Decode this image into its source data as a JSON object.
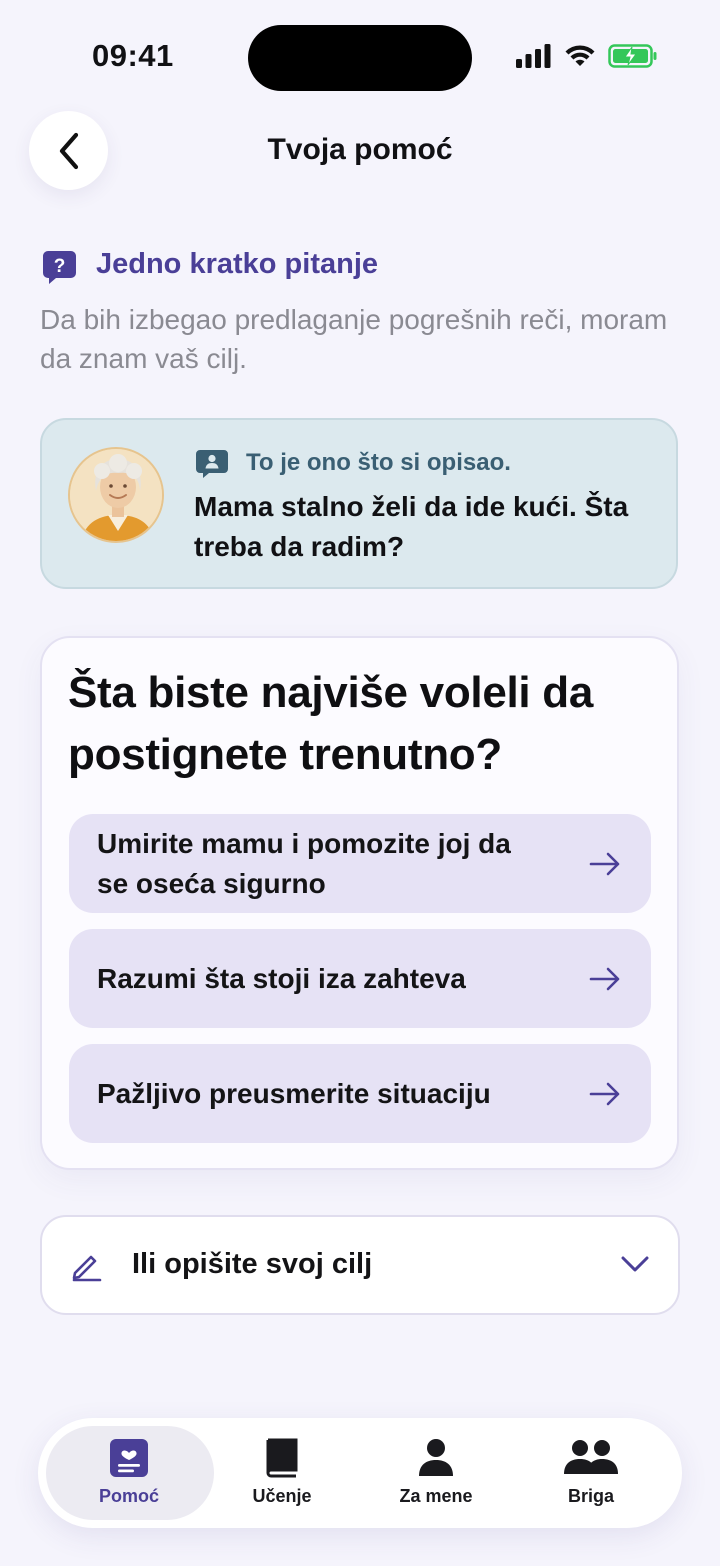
{
  "status_bar": {
    "time": "09:41"
  },
  "header": {
    "title": "Tvoja pomoć"
  },
  "question": {
    "title": "Jedno kratko pitanje",
    "subtitle": "Da bih izbegao predlaganje pogrešnih reči, moram da znam vaš cilj."
  },
  "described": {
    "label": "To je ono što si opisao.",
    "text": "Mama stalno želi da ide kući. Šta treba da radim?"
  },
  "goal": {
    "title": "Šta biste najviše voleli da postignete trenutno?",
    "options": [
      {
        "label": "Umirite mamu i pomozite joj da se oseća sigurno"
      },
      {
        "label": "Razumi šta stoji iza zahteva"
      },
      {
        "label": "Pažljivo preusmerite situaciju"
      }
    ]
  },
  "describe_goal": {
    "label": "Ili opišite svoj cilj"
  },
  "tabs": [
    {
      "label": "Pomoć",
      "icon": "help-card-icon",
      "active": true
    },
    {
      "label": "Učenje",
      "icon": "book-icon",
      "active": false
    },
    {
      "label": "Za mene",
      "icon": "person-icon",
      "active": false
    },
    {
      "label": "Briga",
      "icon": "people-icon",
      "active": false
    }
  ],
  "colors": {
    "accent": "#4A3F97",
    "background": "#F5F4FC",
    "described_card": "#DCE9EE",
    "option_bg": "#E6E2F5",
    "battery": "#34C759"
  }
}
